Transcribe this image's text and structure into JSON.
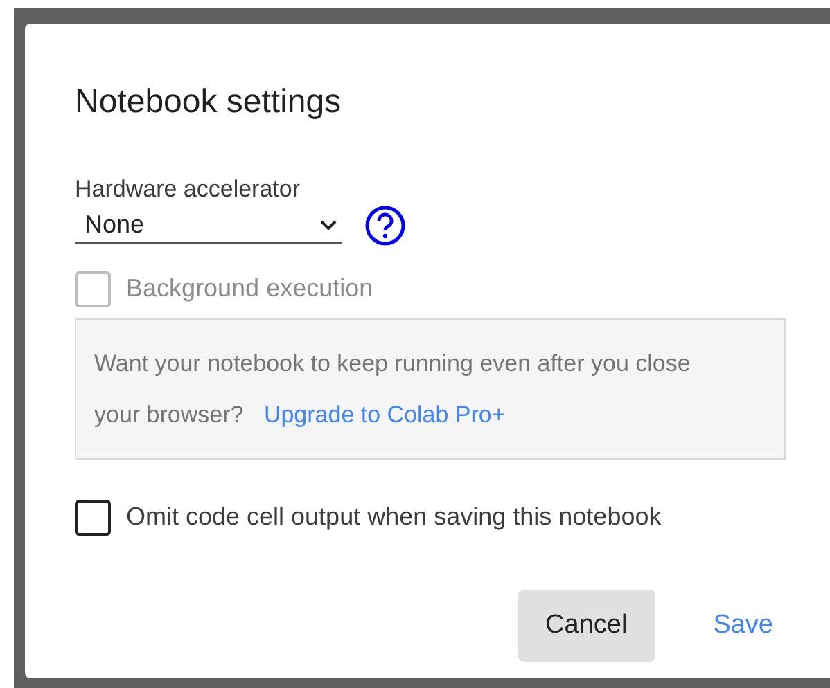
{
  "dialog": {
    "title": "Notebook settings",
    "hardware_accelerator": {
      "label": "Hardware accelerator",
      "value": "None"
    },
    "background_execution": {
      "label": "Background execution",
      "checked": false,
      "disabled": true
    },
    "upgrade_notice": {
      "text": "Want your notebook to keep running even after you close your browser?",
      "link": "Upgrade to Colab Pro+"
    },
    "omit_output": {
      "label": "Omit code cell output when saving this notebook",
      "checked": false,
      "disabled": false
    },
    "buttons": [
      {
        "label": "Cancel",
        "kind": "secondary"
      },
      {
        "label": "Save",
        "kind": "primary"
      }
    ]
  }
}
